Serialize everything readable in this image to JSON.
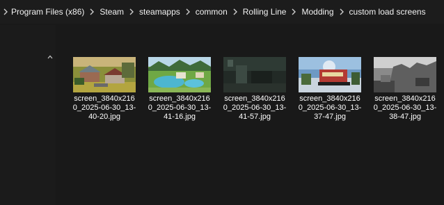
{
  "breadcrumb": {
    "segments": [
      "Program Files (x86)",
      "Steam",
      "steamapps",
      "common",
      "Rolling Line",
      "Modding",
      "custom load screens"
    ]
  },
  "files": [
    {
      "name_lines": [
        "screen_3840x216",
        "0_2025-06-30_13-",
        "40-20.jpg"
      ],
      "thumbnail": "town-scene"
    },
    {
      "name_lines": [
        "screen_3840x216",
        "0_2025-06-30_13-",
        "41-16.jpg"
      ],
      "thumbnail": "pool-scene"
    },
    {
      "name_lines": [
        "screen_3840x216",
        "0_2025-06-30_13-",
        "41-57.jpg"
      ],
      "thumbnail": "dark-scene"
    },
    {
      "name_lines": [
        "screen_3840x216",
        "0_2025-06-30_13-",
        "37-47.jpg"
      ],
      "thumbnail": "train-scene"
    },
    {
      "name_lines": [
        "screen_3840x216",
        "0_2025-06-30_13-",
        "38-47.jpg"
      ],
      "thumbnail": "gray-scene"
    }
  ]
}
